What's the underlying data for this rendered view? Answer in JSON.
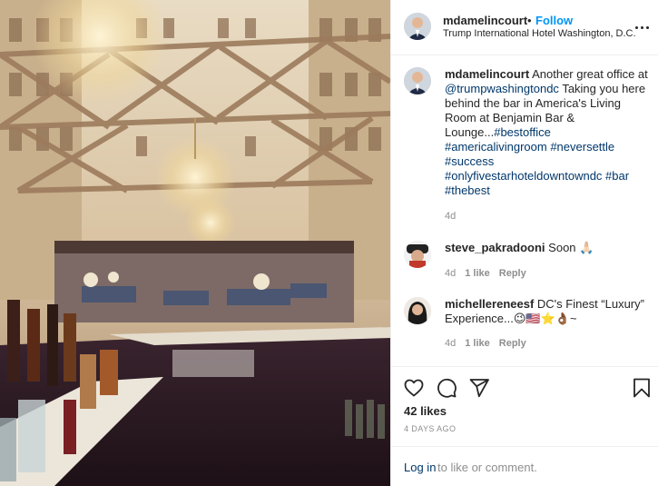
{
  "post": {
    "username": "mdamelincourt",
    "separator": "•",
    "follow_label": "Follow",
    "location": "Trump International Hotel Washington, D.C.",
    "more_icon": "more-horizontal-icon"
  },
  "caption": {
    "username": "mdamelincourt",
    "text_1": "Another great office at ",
    "mention": "@trumpwashingtondc",
    "text_2": " Taking you here behind the bar in America's Living Room at Benjamin Bar & Lounge...",
    "hashtags": "#bestoffice #americalivingroom #neversettle #success #onlyfivestarhoteldowntowndc #bar #thebest",
    "age": "4d"
  },
  "comments": [
    {
      "username": "steve_pakradooni",
      "text": "Soon 🙏🏻",
      "age": "4d",
      "likes": "1 like",
      "reply": "Reply"
    },
    {
      "username": "michellereneesf",
      "text": "DC's Finest “Luxury” Experience...😉🇺🇸⭐👌🏾~",
      "age": "4d",
      "likes": "1 like",
      "reply": "Reply"
    }
  ],
  "actions": {
    "icons": [
      "heart-icon",
      "comment-icon",
      "share-icon",
      "bookmark-icon"
    ],
    "likes": "42 likes",
    "date": "4 DAYS AGO",
    "login_link": "Log in",
    "login_rest": "to like or comment."
  },
  "colors": {
    "accent": "#0095f6",
    "link": "#00376b",
    "muted": "#8e8e8e",
    "border": "#efefef"
  }
}
